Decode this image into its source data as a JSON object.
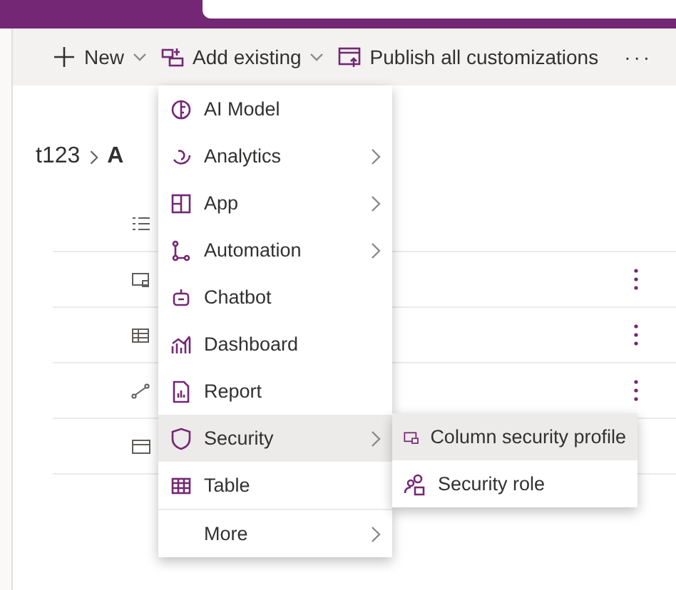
{
  "command_bar": [
    {
      "label": "New",
      "kind": "new",
      "dropdown": true
    },
    {
      "label": "Add existing",
      "kind": "add",
      "dropdown": true
    },
    {
      "label": "Publish all customizations",
      "kind": "publish",
      "dropdown": false
    },
    {
      "label": "···",
      "kind": "overflow",
      "dropdown": false
    }
  ],
  "breadcrumb": [
    "t123",
    "A"
  ],
  "rows": [
    {
      "kind": "list",
      "more": false
    },
    {
      "kind": "form",
      "more": true
    },
    {
      "kind": "grid",
      "more": true
    },
    {
      "kind": "flow",
      "more": true
    },
    {
      "kind": "card",
      "more": false
    }
  ],
  "menu": [
    {
      "label": "AI Model",
      "kind": "brain",
      "submenu": false,
      "selected": false
    },
    {
      "label": "Analytics",
      "kind": "analytics",
      "submenu": true,
      "selected": false
    },
    {
      "label": "App",
      "kind": "app",
      "submenu": true,
      "selected": false
    },
    {
      "label": "Automation",
      "kind": "flow",
      "submenu": true,
      "selected": false
    },
    {
      "label": "Chatbot",
      "kind": "bot",
      "submenu": false,
      "selected": false
    },
    {
      "label": "Dashboard",
      "kind": "dashboard",
      "submenu": false,
      "selected": false
    },
    {
      "label": "Report",
      "kind": "report",
      "submenu": false,
      "selected": false
    },
    {
      "label": "Security",
      "kind": "shield",
      "submenu": true,
      "selected": true
    },
    {
      "label": "Table",
      "kind": "table",
      "submenu": false,
      "selected": false
    },
    {
      "label": "More",
      "kind": "plain",
      "submenu": true,
      "selected": false
    }
  ],
  "submenu": [
    {
      "label": "Column security profile",
      "kind": "colsec",
      "selected": true
    },
    {
      "label": "Security role",
      "kind": "role",
      "selected": false
    }
  ]
}
